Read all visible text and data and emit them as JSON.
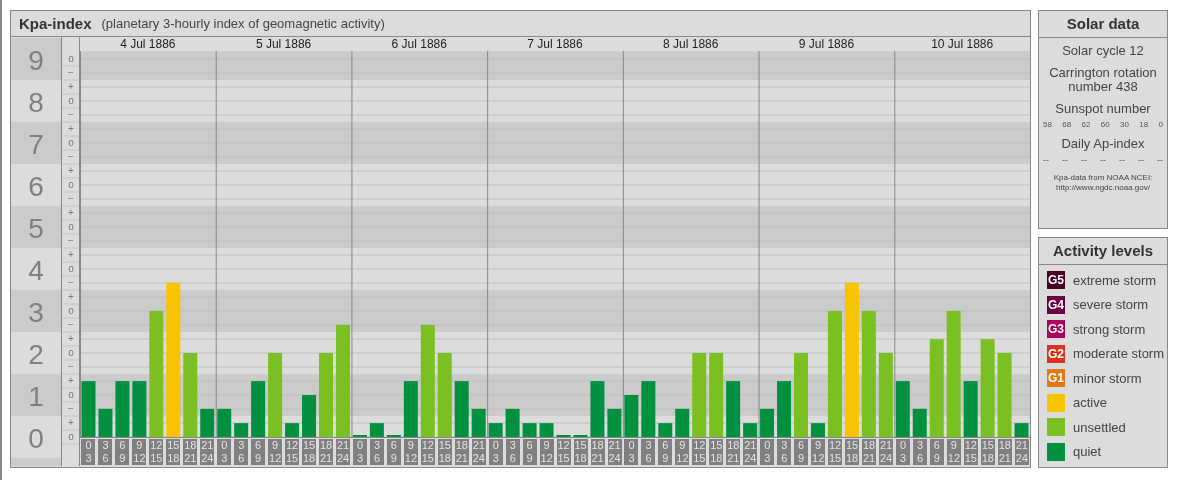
{
  "kpa_panel": {
    "title": "Kpa-index",
    "subtitle": "(planetary 3-hourly index of geomagnetic activity)",
    "days": [
      "4 Jul 1886",
      "5 Jul 1886",
      "6 Jul 1886",
      "7 Jul 1886",
      "8 Jul 1886",
      "9 Jul 1886",
      "10 Jul 1886"
    ],
    "kp_subdivisions": [
      "o",
      "−",
      "+",
      "o",
      "−",
      "+",
      "o",
      "−",
      "+",
      "o",
      "−",
      "+",
      "o",
      "−",
      "+",
      "o",
      "−",
      "+",
      "o",
      "−",
      "+",
      "o",
      "−",
      "+",
      "o",
      "−",
      "+",
      "o"
    ],
    "chart_data": {
      "type": "bar",
      "grid": true,
      "ylim": [
        0,
        9.19
      ],
      "categories": [
        "0 3",
        "3 6",
        "6 9",
        "9 12",
        "12 15",
        "15 18",
        "18 21",
        "21 24",
        "0 3",
        "3 6",
        "6 9",
        "9 12",
        "12 15",
        "15 18",
        "18 21",
        "21 24",
        "0 3",
        "3 6",
        "6 9",
        "9 12",
        "12 15",
        "15 18",
        "18 21",
        "21 24",
        "0 3",
        "3 6",
        "6 9",
        "9 12",
        "12 15",
        "15 18",
        "18 21",
        "21 24",
        "0 3",
        "3 6",
        "6 9",
        "9 12",
        "12 15",
        "15 18",
        "18 21",
        "21 24",
        "0 3",
        "3 6",
        "6 9",
        "9 12",
        "12 15",
        "15 18",
        "18 21",
        "21 24",
        "0 3",
        "3 6",
        "6 9",
        "9 12",
        "12 15",
        "15 18",
        "18 21",
        "21 24"
      ],
      "yticks": [
        {
          "value": 9,
          "label": "9"
        },
        {
          "value": 8,
          "label": "8"
        },
        {
          "value": 7,
          "label": "7"
        },
        {
          "value": 6,
          "label": "6"
        },
        {
          "value": 5,
          "label": "5"
        },
        {
          "value": 4,
          "label": "4"
        },
        {
          "value": 3,
          "label": "3"
        },
        {
          "value": 2,
          "label": "2"
        },
        {
          "value": 1,
          "label": "1"
        },
        {
          "value": 0,
          "label": "0"
        }
      ],
      "series": [
        {
          "name": "active",
          "color": "#f8c300",
          "values": [
            null,
            null,
            null,
            null,
            null,
            3.67,
            null,
            null,
            null,
            null,
            null,
            null,
            null,
            null,
            null,
            null,
            null,
            null,
            null,
            null,
            null,
            null,
            null,
            null,
            null,
            null,
            null,
            null,
            null,
            null,
            null,
            null,
            null,
            null,
            null,
            null,
            null,
            null,
            null,
            null,
            null,
            null,
            null,
            null,
            null,
            3.67,
            null,
            null,
            null,
            null,
            null,
            null,
            null,
            null,
            null,
            null
          ]
        },
        {
          "name": "unsettled",
          "color": "#7bc022",
          "values": [
            null,
            null,
            null,
            null,
            3,
            null,
            2,
            null,
            null,
            null,
            null,
            2,
            null,
            null,
            2,
            2.67,
            null,
            null,
            null,
            null,
            2.67,
            2,
            null,
            null,
            null,
            null,
            null,
            null,
            null,
            null,
            null,
            null,
            null,
            null,
            null,
            null,
            2,
            2,
            null,
            null,
            null,
            null,
            2,
            null,
            3,
            null,
            3,
            2,
            null,
            null,
            2.33,
            3,
            null,
            2.33,
            2,
            null
          ]
        },
        {
          "name": "quiet",
          "color": "#00903f",
          "values": [
            1.33,
            0.67,
            1.33,
            1.33,
            null,
            null,
            null,
            0.67,
            0.67,
            0.33,
            1.33,
            null,
            0.33,
            1,
            null,
            null,
            0,
            0.33,
            0,
            1.33,
            null,
            null,
            1.33,
            0.67,
            0.33,
            0.67,
            0.33,
            0.33,
            0,
            0,
            1.33,
            0.67,
            1,
            1.33,
            0.33,
            0.67,
            null,
            null,
            1.33,
            0.33,
            0.67,
            1.33,
            null,
            0.33,
            null,
            null,
            null,
            null,
            1.33,
            0.67,
            null,
            null,
            1.33,
            null,
            null,
            0.33
          ]
        }
      ]
    }
  },
  "solar_data": {
    "title": "Solar data",
    "solar_cycle": "Solar cycle 12",
    "carrington": "Carrington rotation number 438",
    "sunspot_label": "Sunspot number",
    "sunspot_numbers": [
      "58",
      "68",
      "62",
      "60",
      "30",
      "18",
      "0"
    ],
    "ap_label": "Daily Ap-index",
    "ap_values": [
      "--",
      "--",
      "--",
      "--",
      "--",
      "--",
      "--"
    ],
    "source": "Kpa-data from NOAA NCEI:",
    "source_url": "http://www.ngdc.noaa.gov/"
  },
  "activity_levels": {
    "title": "Activity levels",
    "items": [
      {
        "badge": "G5",
        "label": "extreme storm",
        "color": "#4a0024"
      },
      {
        "badge": "G4",
        "label": "severe storm",
        "color": "#6c0042"
      },
      {
        "badge": "G3",
        "label": "strong storm",
        "color": "#ad005c"
      },
      {
        "badge": "G2",
        "label": "moderate storm",
        "color": "#d8341c"
      },
      {
        "badge": "G1",
        "label": "minor storm",
        "color": "#e0791a"
      }
    ]
  }
}
